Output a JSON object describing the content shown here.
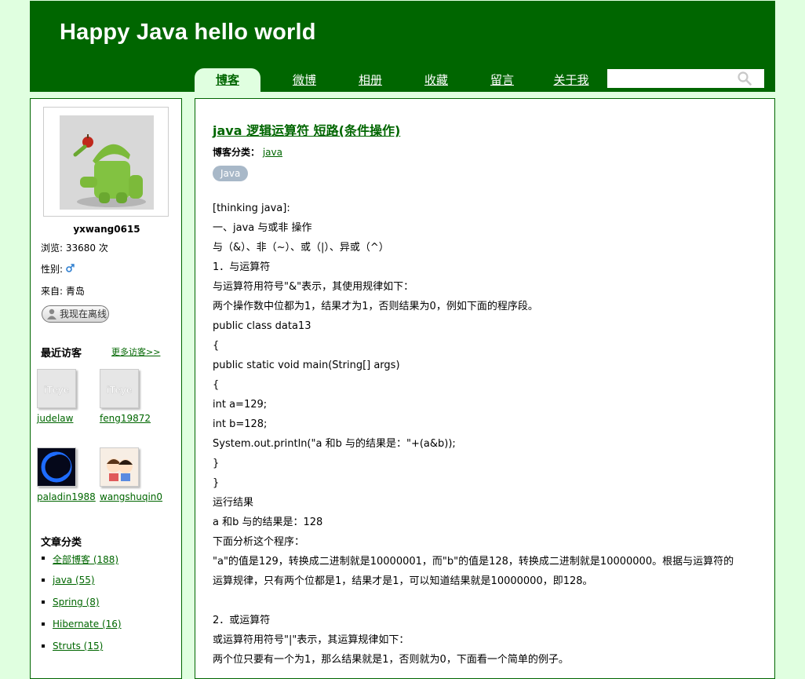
{
  "site": {
    "title": "Happy Java hello world"
  },
  "nav": {
    "items": [
      {
        "label": "博客"
      },
      {
        "label": "微博"
      },
      {
        "label": "相册"
      },
      {
        "label": "收藏"
      },
      {
        "label": "留言"
      },
      {
        "label": "关于我"
      }
    ],
    "active_index": 0
  },
  "search": {
    "value": "",
    "placeholder": ""
  },
  "sidebar": {
    "username": "yxwang0615",
    "views": "浏览: 33680 次",
    "gender_label": "性别:",
    "location": "来自: 青岛",
    "offline_label": "我现在离线",
    "recent_visitors_heading": "最近访客",
    "more_visitors_label": "更多访客>>",
    "visitors": [
      {
        "name": "judelaw",
        "avatar": "iteye-logo"
      },
      {
        "name": "feng19872",
        "avatar": "iteye-logo"
      },
      {
        "name": "paladin1988",
        "avatar": "dark-ring"
      },
      {
        "name": "wangshuqin0",
        "avatar": "cartoon-couple"
      }
    ],
    "categories_heading": "文章分类",
    "categories": [
      {
        "label": "全部博客 (188)"
      },
      {
        "label": "java (55)"
      },
      {
        "label": "Spring (8)"
      },
      {
        "label": "Hibernate (16)"
      },
      {
        "label": "Struts (15)"
      }
    ]
  },
  "post": {
    "title": "java 逻辑运算符 短路(条件操作)",
    "category_label": "博客分类：",
    "category_link": "java",
    "tag": "Java",
    "lines": [
      "[thinking java]:",
      "一、java 与或非 操作",
      "与（&）、非（~）、或（|）、异或（^）",
      "1．与运算符",
      "与运算符用符号\"&\"表示，其使用规律如下：",
      "两个操作数中位都为1，结果才为1，否则结果为0，例如下面的程序段。",
      "public class data13",
      "{",
      "public static void main(String[] args)",
      "{",
      "int a=129;",
      "int b=128;",
      "System.out.println(\"a 和b 与的结果是：\"+(a&b));",
      "}",
      "}",
      "运行结果",
      "a 和b 与的结果是：128",
      "下面分析这个程序：",
      "\"a\"的值是129，转换成二进制就是10000001，而\"b\"的值是128，转换成二进制就是10000000。根据与运算符的",
      "运算规律，只有两个位都是1，结果才是1，可以知道结果就是10000000，即128。",
      "",
      "2．或运算符",
      "或运算符用符号\"|\"表示，其运算规律如下：",
      "两个位只要有一个为1，那么结果就是1，否则就为0，下面看一个简单的例子。"
    ]
  },
  "colors": {
    "brand": "#006600",
    "page_bg": "#e0ffe0",
    "tag_bg": "#a8b8c8"
  }
}
